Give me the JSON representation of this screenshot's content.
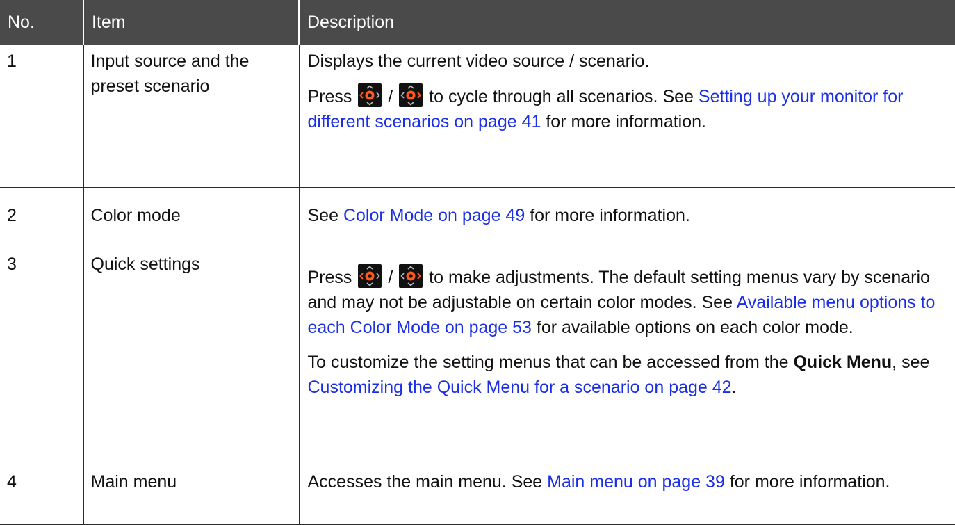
{
  "table": {
    "headers": [
      "No.",
      "Item",
      "Description"
    ],
    "rows": [
      {
        "no": "1",
        "item": "Input source and the preset scenario",
        "desc_p1": "Displays the current video source / scenario.",
        "desc_p2": {
          "pre": "Press",
          "sep": "/",
          "mid": "to cycle through all scenarios. See",
          "link": "Setting up your monitor for different scenarios on page 41",
          "post": "for more information."
        }
      },
      {
        "no": "2",
        "item": "Color mode",
        "desc": {
          "pre": "See",
          "link": "Color Mode on page 49",
          "post": "for more information."
        }
      },
      {
        "no": "3",
        "item": "Quick settings",
        "desc_p1": {
          "pre": "Press",
          "sep": "/",
          "mid": "to make adjustments. The default setting menus vary by scenario and may not be adjustable on certain color modes. See",
          "link": "Available menu options to each Color Mode on page 53",
          "post": "for available options on each color mode."
        },
        "desc_p2": {
          "pre": "To customize the setting menus that can be accessed from the",
          "bold": "Quick Menu",
          "mid": ", see",
          "link": "Customizing the Quick Menu for a scenario on page 42",
          "post": "."
        }
      },
      {
        "no": "4",
        "item": "Main menu",
        "desc": {
          "pre": "Accesses the main menu. See",
          "link": "Main menu on page 39",
          "post": "for more information."
        }
      }
    ]
  },
  "icons": {
    "left_control": "controller-left-highlight-icon",
    "right_control": "controller-right-highlight-icon"
  },
  "colors": {
    "header_bg": "#4a4a4a",
    "link": "#1a2ee8",
    "icon_highlight": "#ff5a1a"
  }
}
